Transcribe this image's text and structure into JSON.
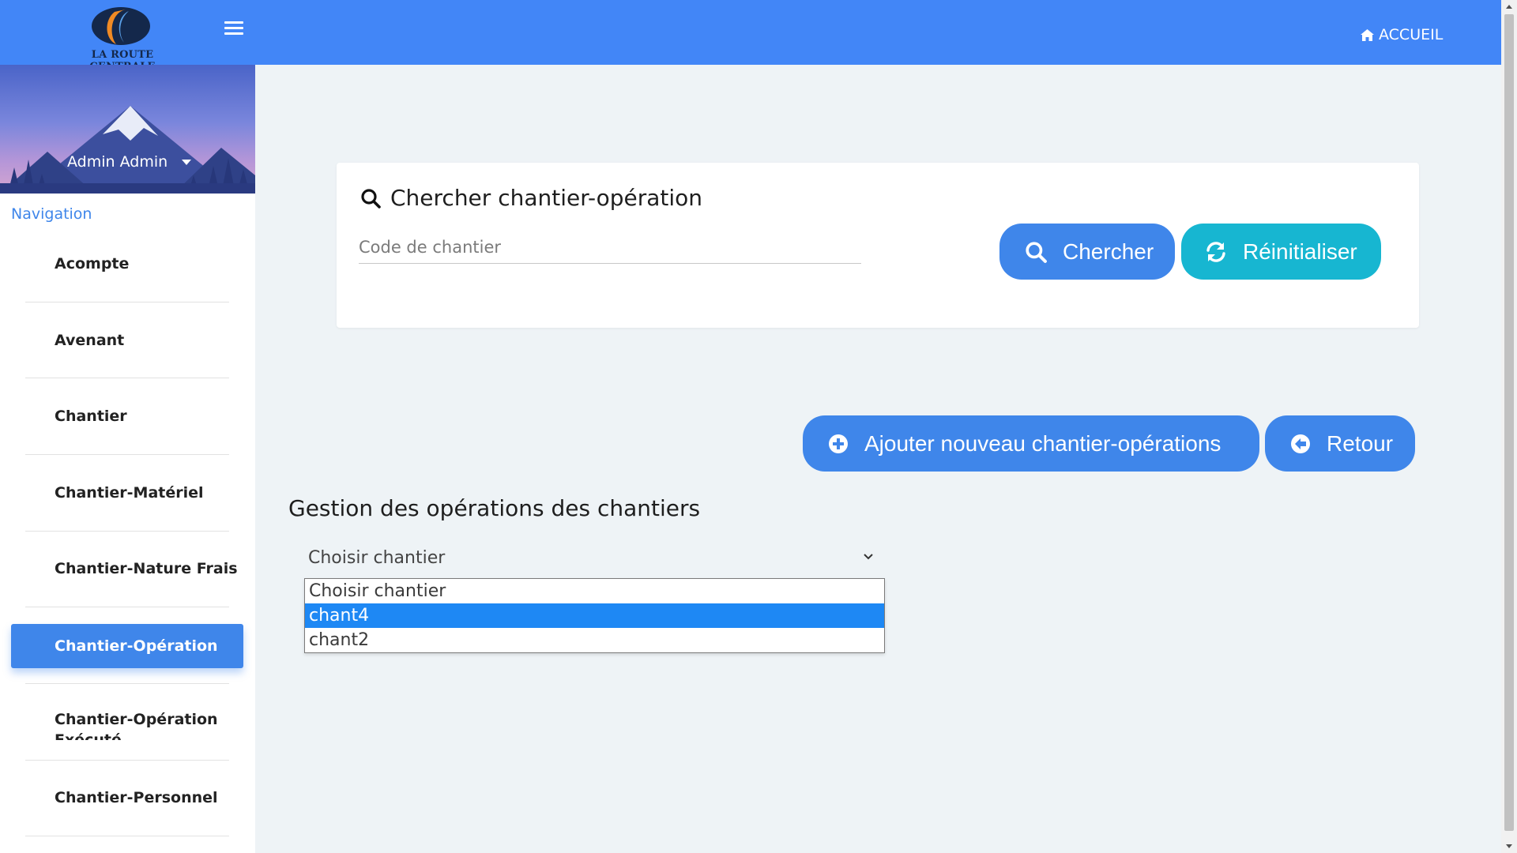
{
  "header": {
    "logo_text": "LA ROUTE CENTRALE",
    "home_label": "ACCUEIL",
    "brand_color": "#4286f7"
  },
  "sidebar": {
    "user_name": "Admin Admin",
    "nav_title": "Navigation",
    "items": [
      {
        "label": "Acompte",
        "active": false
      },
      {
        "label": "Avenant",
        "active": false
      },
      {
        "label": "Chantier",
        "active": false
      },
      {
        "label": "Chantier-Matériel",
        "active": false
      },
      {
        "label": "Chantier-Nature Frais",
        "active": false
      },
      {
        "label": "Chantier-Opération",
        "active": true
      },
      {
        "label": "Chantier-Opération Exécuté",
        "active": false
      },
      {
        "label": "Chantier-Personnel",
        "active": false
      }
    ]
  },
  "search": {
    "title": "Chercher chantier-opération",
    "placeholder": "Code de chantier",
    "value": "",
    "search_button": "Chercher",
    "reset_button": "Réinitialiser"
  },
  "actions": {
    "add_button": "Ajouter nouveau chantier-opérations",
    "back_button": "Retour"
  },
  "main": {
    "section_title": "Gestion des opérations des chantiers",
    "select": {
      "value": "Choisir chantier",
      "options": [
        {
          "label": "Choisir chantier",
          "selected": false
        },
        {
          "label": "chant4",
          "selected": true
        },
        {
          "label": "chant2",
          "selected": false
        }
      ]
    }
  },
  "colors": {
    "primary": "#3f86ea",
    "info": "#17b6d1",
    "highlight": "#1e88f4",
    "page_bg": "#eef3f6"
  }
}
